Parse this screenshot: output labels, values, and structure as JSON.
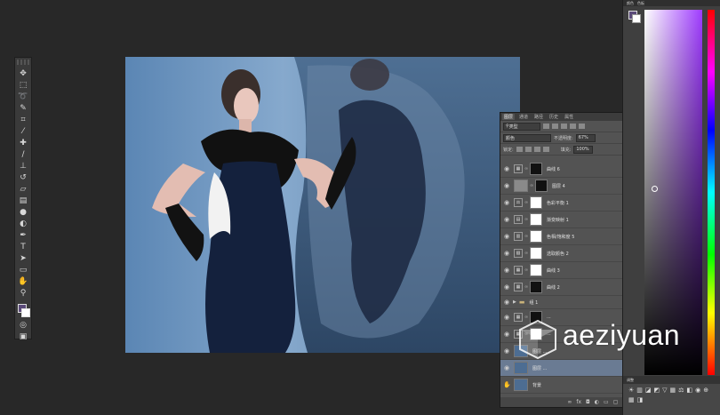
{
  "tools": {
    "icons": [
      "move-icon",
      "marquee-icon",
      "lasso-icon",
      "quick-select-icon",
      "crop-icon",
      "eyedropper-icon",
      "healing-icon",
      "brush-icon",
      "clone-stamp-icon",
      "history-brush-icon",
      "eraser-icon",
      "gradient-icon",
      "blur-icon",
      "dodge-icon",
      "pen-icon",
      "type-icon",
      "path-select-icon",
      "shape-icon",
      "hand-icon",
      "zoom-icon"
    ]
  },
  "layers_panel": {
    "tabs": [
      "图层",
      "通道",
      "路径",
      "历史",
      "属性"
    ],
    "filter_kind": "类型",
    "blend_mode": "颜色",
    "opacity_label": "不透明度:",
    "opacity_value": "67%",
    "lock_label": "锁定:",
    "fill_label": "填充:",
    "fill_value": "100%",
    "layers": [
      {
        "name": "曲线 6",
        "type": "adjustment",
        "mask": "dark"
      },
      {
        "name": "图层 4",
        "type": "pixel",
        "mask": "dark"
      },
      {
        "name": "色彩平衡 1",
        "type": "adjustment",
        "mask": "white"
      },
      {
        "name": "渐变映射 1",
        "type": "adjustment",
        "mask": "white"
      },
      {
        "name": "色相/饱和度 5",
        "type": "adjustment",
        "mask": "white"
      },
      {
        "name": "选取颜色 2",
        "type": "adjustment",
        "mask": "white"
      },
      {
        "name": "曲线 3",
        "type": "adjustment",
        "mask": "white"
      },
      {
        "name": "曲线 2",
        "type": "adjustment",
        "mask": "dark"
      },
      {
        "name": "组 1",
        "type": "group",
        "mask": ""
      },
      {
        "name": "...",
        "type": "adjustment",
        "mask": "dark"
      },
      {
        "name": "...",
        "type": "adjustment",
        "mask": "white"
      },
      {
        "name": "图层 ...",
        "type": "pixel",
        "mask": ""
      },
      {
        "name": "图层 ...",
        "type": "pixel",
        "mask": ""
      },
      {
        "name": "背景",
        "type": "background",
        "mask": ""
      }
    ]
  },
  "color_panel": {
    "tabs": [
      "颜色",
      "色板"
    ],
    "foreground": "#5a4a79",
    "background": "#ffffff"
  },
  "adjustments_panel": {
    "tab": "调整"
  },
  "watermark": {
    "text": "aeziyuan"
  }
}
